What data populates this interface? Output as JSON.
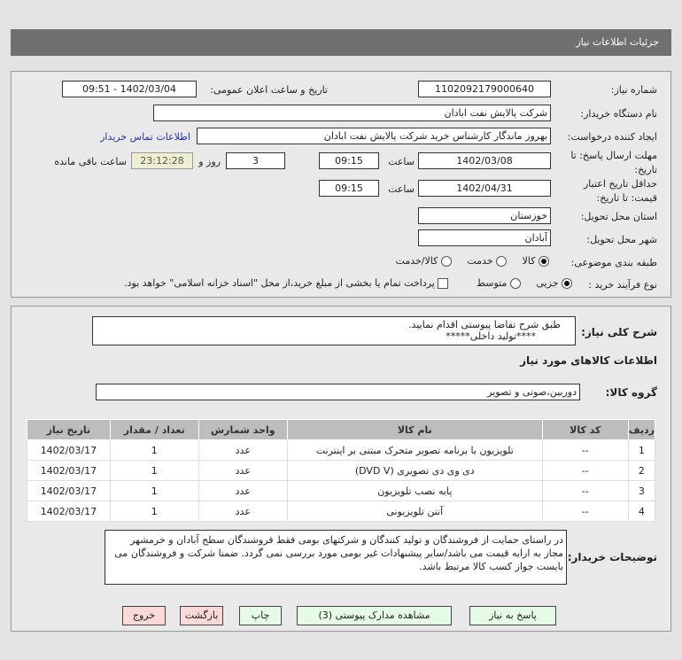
{
  "header": {
    "title": "جزئیات اطلاعات نیاز"
  },
  "form": {
    "need_number_label": "شماره نیاز:",
    "need_number": "1102092179000640",
    "announce_label": "تاریخ و ساعت اعلان عمومی:",
    "announce_value": "1402/03/04 - 09:51",
    "buyer_label": "نام دستگاه خریدار:",
    "buyer": "شرکت پالایش نفت ابادان",
    "creator_label": "ایجاد کننده درخواست:",
    "creator": "بهروز ماندگار کارشناس خرید شرکت پالایش نفت ابادان",
    "contact_link": "اطلاعات تماس خریدار",
    "deadline_label": "مهلت ارسال پاسخ: تا تاریخ:",
    "deadline_date": "1402/03/08",
    "time_label": "ساعت",
    "deadline_time": "09:15",
    "days": "3",
    "days_label": "روز و",
    "remaining": "23:12:28",
    "remaining_label": "ساعت باقی مانده",
    "validity_label": "حداقل تاریخ اعتبار قیمت: تا تاریخ:",
    "validity_date": "1402/04/31",
    "validity_time": "09:15",
    "province_label": "استان محل تحویل:",
    "province": "خوزستان",
    "city_label": "شهر محل تحویل:",
    "city": "آبادان",
    "category_label": "طبقه بندی موضوعی:",
    "category_options": [
      "کالا",
      "خدمت",
      "کالا/خدمت"
    ],
    "category_selected": "کالا",
    "process_label": "نوع فرآیند خرید :",
    "process_options": [
      "جزیی",
      "متوسط"
    ],
    "process_selected": "جزیی",
    "payment_note": "پرداخت تمام یا بخشی از مبلغ خرید،از محل \"اسناد خزانه اسلامی\" خواهد بود."
  },
  "details": {
    "desc_label": "شرح کلی نیاز:",
    "desc_line1": "طبق شرح تقاضا پیوستی اقدام نمایید.",
    "desc_line2": "****تولید داخلی*****",
    "goods_title": "اطلاعات کالاهای مورد نیاز",
    "group_label": "گروه کالا:",
    "group": "دوربین،صوتی و تصویر",
    "columns": [
      "ردیف",
      "کد کالا",
      "نام کالا",
      "واحد شمارش",
      "تعداد / مقدار",
      "تاریخ نیاز"
    ],
    "rows": [
      [
        "1",
        "--",
        "تلویزیون با برنامه تصویر متحرک مبتنی بر اینترنت",
        "عدد",
        "1",
        "1402/03/17"
      ],
      [
        "2",
        "--",
        "دی وی دی تصویری (DVD V)",
        "عدد",
        "1",
        "1402/03/17"
      ],
      [
        "3",
        "--",
        "پایه نصب تلویزیون",
        "عدد",
        "1",
        "1402/03/17"
      ],
      [
        "4",
        "--",
        "آنتن تلویزیونی",
        "عدد",
        "1",
        "1402/03/17"
      ]
    ],
    "notes_label": "توضیحات خریدار:",
    "notes": "در راستای حمایت از فروشندگان و تولید کنندگان و شرکتهای بومی فقط فروشندگان سطح آبادان و خرمشهر مجاز به ارایه قیمت می باشد/سایر پیشنهادات غیر بومی مورد بررسی نمی گردد. ضمنا شرکت و فروشندگان می بایست جواز کسب کالا مرتبط باشد."
  },
  "buttons": {
    "reply": "پاسخ به نیاز",
    "attachments": "مشاهده مدارک پیوستی (3)",
    "print": "چاپ",
    "back": "بازگشت",
    "exit": "خروج"
  }
}
